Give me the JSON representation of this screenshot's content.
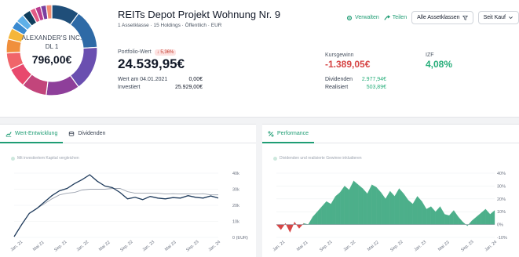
{
  "portfolio": {
    "owner_name": "ALEXANDER'S INC.",
    "owner_sub": "DL 1",
    "donut_value": "796,00€",
    "title": "REITs Depot Projekt Wohnung Nr. 9",
    "subtitle": "1 Assetklasse · 15 Holdings · Öffentlich · EUR",
    "donut_colors": [
      "#1f4e79",
      "#2e6aa6",
      "#6a4fb0",
      "#8e3f9a",
      "#c2457b",
      "#e8496d",
      "#f0656a",
      "#f08f3c",
      "#f5b63a",
      "#3a8ad0",
      "#5fb0e8",
      "#0f3d5c",
      "#e25c86",
      "#b83c8e",
      "#7a3fa0",
      "#f38d72"
    ],
    "donut_weights": [
      10,
      14,
      16,
      12,
      9,
      7,
      6,
      5,
      4,
      3,
      3,
      3,
      2,
      2,
      2,
      2
    ]
  },
  "actions": {
    "manage": "Verwalten",
    "share": "Teilen",
    "asset_filter": "Alle Assetklassen",
    "since": "Seit Kauf"
  },
  "kpis": {
    "value_label": "Portfolio-Wert",
    "value_change": "5,36%",
    "value": "24.539,95€",
    "value_date_label": "Wert am 04.01.2021",
    "value_date_amount": "0,00€",
    "invested_label": "Investiert",
    "invested_amount": "25.929,00€",
    "gain_label": "Kursgewinn",
    "gain": "-1.389,05€",
    "irr_label": "IZF",
    "irr": "4,08%",
    "dividends_label": "Dividenden",
    "dividends": "2.977,94€",
    "realized_label": "Realisiert",
    "realized": "503,89€"
  },
  "colors": {
    "accent": "#1f9d74",
    "negative": "#d64545",
    "positive": "#27ae7a",
    "line_value": "#1f3b5c",
    "line_invested": "#9ca3af",
    "area_positive": "#4caf8a",
    "area_negative": "#d64545"
  },
  "left_card": {
    "tab_value": "Wert-Entwicklung",
    "tab_dividends": "Dividenden",
    "legend": "Mit investiertem Kapital vergleichen"
  },
  "right_card": {
    "tab_performance": "Performance",
    "legend": "Dividenden und realisierte Gewinne inkludieren"
  },
  "chart_data": [
    {
      "type": "line",
      "title": "",
      "x": [
        "Jan. 21",
        "Mai 21",
        "Sep. 21",
        "Jan. 22",
        "Mai 22",
        "Sep. 22",
        "Jan. 23",
        "Mai 23",
        "Sep. 23",
        "Jan. 24"
      ],
      "yticks": [
        "40k",
        "30k",
        "20k",
        "10k",
        "0 (EUR)"
      ],
      "ylim": [
        0,
        40000
      ],
      "series": [
        {
          "name": "",
          "values": [
            500,
            8000,
            15000,
            18000,
            22000,
            26000,
            29000,
            30500,
            33500,
            36000,
            39000,
            35000,
            32000,
            31000,
            28000,
            24000,
            25000,
            23500,
            25500,
            24500,
            24000,
            24800,
            24500,
            26000,
            25000,
            24500,
            25800,
            24500
          ]
        },
        {
          "name": "",
          "values": [
            500,
            8000,
            15000,
            18000,
            21000,
            24000,
            26500,
            27500,
            28000,
            29500,
            30000,
            30000,
            30000,
            30500,
            30500,
            28500,
            27500,
            27500,
            27500,
            27500,
            27000,
            27200,
            27000,
            27000,
            27000,
            27200,
            26500,
            26500
          ]
        }
      ]
    },
    {
      "type": "area",
      "title": "",
      "x": [
        "Jan. 21",
        "Mai 21",
        "Sep. 21",
        "Jan. 22",
        "Mai 22",
        "Sep. 22",
        "Jan. 23",
        "Mai 23",
        "Sep. 23",
        "Jan. 24"
      ],
      "yticks": [
        "40%",
        "30%",
        "20%",
        "10%",
        "0%",
        "-10%"
      ],
      "ylim": [
        -10,
        40
      ],
      "values": [
        0,
        -4,
        1,
        -6,
        2,
        -3,
        1,
        0,
        6,
        10,
        14,
        18,
        16,
        22,
        25,
        30,
        27,
        34,
        31,
        28,
        24,
        31,
        29,
        25,
        20,
        26,
        22,
        28,
        24,
        19,
        16,
        22,
        18,
        12,
        14,
        10,
        14,
        8,
        7,
        11,
        6,
        2,
        -1,
        3,
        6,
        9,
        12,
        8,
        11
      ]
    }
  ]
}
